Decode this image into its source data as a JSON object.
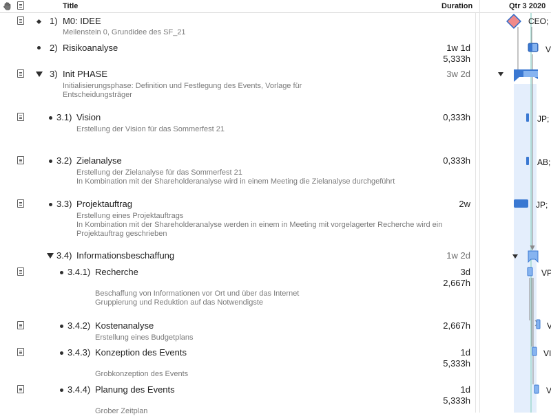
{
  "header": {
    "title_col": "Title",
    "duration_col": "Duration",
    "quarter": "Qtr 3 2020",
    "hand_icon": "hand-icon",
    "note_icon": "note-icon"
  },
  "tasks": [
    {
      "num": "1)",
      "title": "M0: IDEE",
      "note": "Meilenstein 0, Grundidee des SF_21",
      "resource": "CEO;"
    },
    {
      "num": "2)",
      "title": "Risikoanalyse",
      "dur1": "1w 1d",
      "dur2": "5,333h",
      "resource": "V"
    },
    {
      "num": "3)",
      "title": "Init PHASE",
      "note1": "Initialisierungsphase: Definition und Festlegung des Events, Vorlage für",
      "note2": "Entscheidungsträger",
      "dur1": "3w 2d"
    },
    {
      "num": "3.1)",
      "title": "Vision",
      "note": "Erstellung der Vision für das Sommerfest 21",
      "dur1": "0,333h",
      "resource": "JP;"
    },
    {
      "num": "3.2)",
      "title": "Zielanalyse",
      "note1": "Erstellung der Zielanalyse für das Sommerfest 21",
      "note2": "In Kombination mit der Shareholderanalyse wird in einem Meeting die Zielanalyse durchgeführt",
      "dur1": "0,333h",
      "resource": "AB;"
    },
    {
      "num": "3.3)",
      "title": "Projektauftrag",
      "note1": "Erstellung eines Projektauftrags",
      "note2": "In Kombination mit der Shareholderanalyse werden in einem in Meeting mit vorgelagerter Recherche wird ein",
      "note3": "Projektauftrag geschrieben",
      "dur1": "2w",
      "resource": "JP;"
    },
    {
      "num": "3.4)",
      "title": "Informationsbeschaffung",
      "dur1": "1w 2d"
    },
    {
      "num": "3.4.1)",
      "title": "Recherche",
      "note1": "Beschaffung von Informationen vor Ort und über das Internet",
      "note2": "Gruppierung und Reduktion auf das Notwendigste",
      "dur1": "3d",
      "dur2": "2,667h",
      "resource": "VP"
    },
    {
      "num": "3.4.2)",
      "title": "Kostenanalyse",
      "note": "Erstellung eines Budgetplans",
      "dur1": "2,667h",
      "resource": "V"
    },
    {
      "num": "3.4.3)",
      "title": "Konzeption des Events",
      "note": "Grobkonzeption des Events",
      "dur1": "1d",
      "dur2": "5,333h",
      "resource": "VI"
    },
    {
      "num": "3.4.4)",
      "title": "Planung des Events",
      "note": "Grober Zeitplan",
      "dur1": "1d",
      "dur2": "5,333h",
      "resource": "V"
    }
  ],
  "colors": {
    "bar": "#3a78d2",
    "bar_light": "#86b4f0",
    "milestone_fill": "#f08a8a",
    "milestone_border": "#2f6bc9",
    "phase_band": "#e4eefc",
    "today_line": "#9fd9cf"
  }
}
